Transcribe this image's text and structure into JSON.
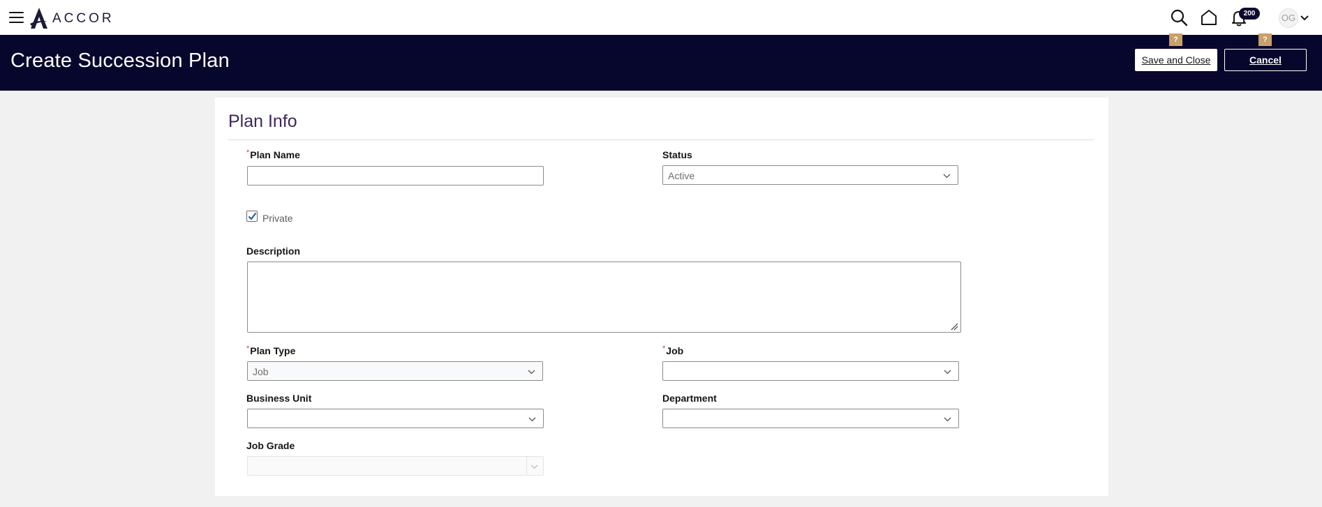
{
  "brand": {
    "name": "ACCOR"
  },
  "topbar": {
    "notification_count": "200",
    "avatar_initials": "OG",
    "icons": [
      "menu-icon",
      "search-icon",
      "home-icon",
      "bell-icon",
      "chevron-down-icon"
    ]
  },
  "header": {
    "title": "Create Succession Plan",
    "help_marker": "?",
    "save_label": "Save and Close",
    "cancel_label": "Cancel"
  },
  "form": {
    "section_title": "Plan Info",
    "required_marker": "*",
    "plan_name": {
      "label": "Plan Name",
      "value": ""
    },
    "status": {
      "label": "Status",
      "value": "Active"
    },
    "private": {
      "label": "Private",
      "checked": true
    },
    "description": {
      "label": "Description",
      "value": ""
    },
    "plan_type": {
      "label": "Plan Type",
      "value": "Job"
    },
    "job": {
      "label": "Job",
      "value": ""
    },
    "business_unit": {
      "label": "Business Unit",
      "value": ""
    },
    "department": {
      "label": "Department",
      "value": ""
    },
    "job_grade": {
      "label": "Job Grade",
      "value": ""
    }
  },
  "colors": {
    "header_bg": "#07062c",
    "help_tag": "#c8a06a",
    "section_title": "#3d2759",
    "required": "#c74634",
    "checkbox_check": "#1f5fa8"
  }
}
